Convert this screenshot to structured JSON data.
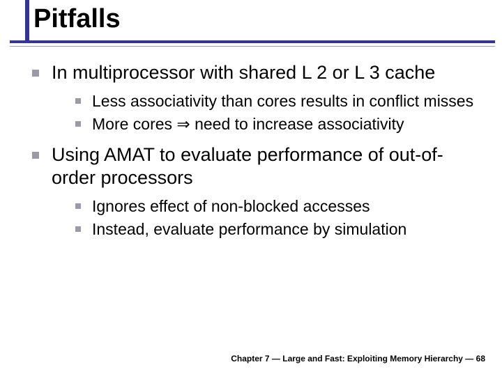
{
  "title": "Pitfalls",
  "bullets": [
    {
      "text": "In multiprocessor with shared L 2 or L 3 cache",
      "children": [
        {
          "text": "Less associativity than cores results in conflict misses"
        },
        {
          "text": "More cores ⇒ need to increase associativity"
        }
      ]
    },
    {
      "text": "Using AMAT to evaluate performance of out-of-order processors",
      "children": [
        {
          "text": "Ignores effect of non-blocked accesses"
        },
        {
          "text": "Instead, evaluate performance by simulation"
        }
      ]
    }
  ],
  "footer": "Chapter 7 — Large and Fast: Exploiting Memory Hierarchy — 68"
}
